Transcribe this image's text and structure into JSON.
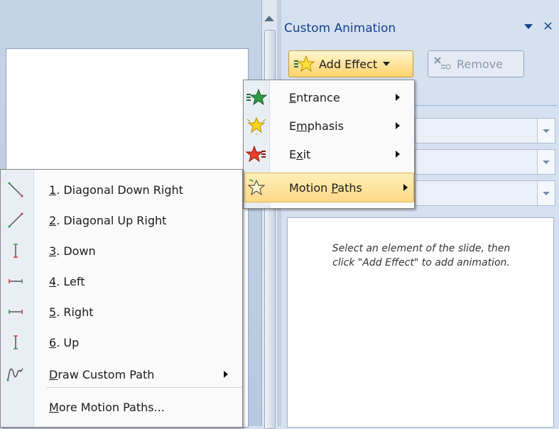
{
  "task_pane": {
    "title": "Custom Animation",
    "close_glyph": "×",
    "add_effect_label": "Add Effect",
    "remove_label": "Remove",
    "hint_line1": "Select an element of the slide, then",
    "hint_line2": "click \"Add Effect\" to add animation."
  },
  "add_effect_menu": {
    "items": [
      {
        "label": "Entrance",
        "mnemonic": "E",
        "rest": "ntrance",
        "icon": "entrance-star-icon"
      },
      {
        "label": "Emphasis",
        "pre": "E",
        "mnemonic": "m",
        "rest": "phasis",
        "icon": "emphasis-star-icon"
      },
      {
        "label": "Exit",
        "pre": "E",
        "mnemonic": "x",
        "rest": "it",
        "icon": "exit-star-icon"
      },
      {
        "label": "Motion Paths",
        "pre": "Motion ",
        "mnemonic": "P",
        "rest": "aths",
        "icon": "motion-path-star-icon"
      }
    ]
  },
  "motion_paths_menu": {
    "items": [
      {
        "num": "1",
        "label": ". Diagonal Down Right",
        "icon": "diagonal-down-right-icon"
      },
      {
        "num": "2",
        "label": ". Diagonal Up Right",
        "icon": "diagonal-up-right-icon"
      },
      {
        "num": "3",
        "label": ". Down",
        "icon": "down-path-icon"
      },
      {
        "num": "4",
        "label": ". Left",
        "icon": "left-path-icon"
      },
      {
        "num": "5",
        "label": ". Right",
        "icon": "right-path-icon"
      },
      {
        "num": "6",
        "label": ". Up",
        "icon": "up-path-icon"
      },
      {
        "mnemonic": "D",
        "label": "raw Custom Path",
        "icon": "custom-path-icon"
      },
      {
        "mnemonic": "M",
        "label": "ore Motion Paths...",
        "icon": ""
      }
    ]
  },
  "colors": {
    "pane_title": "#15428b",
    "highlight": "#ffd987",
    "add_effect_bg": "#ffd36b"
  }
}
